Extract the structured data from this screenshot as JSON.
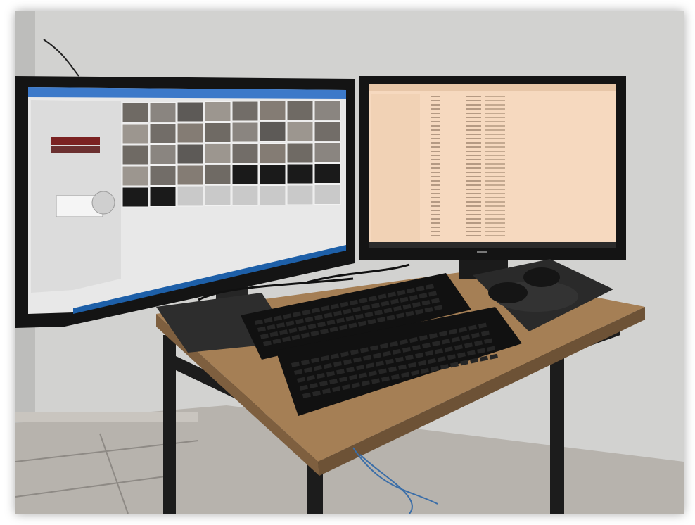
{
  "photo": {
    "subject": "",
    "colors": {
      "wall": "#d2d2d0",
      "wall_shadow": "#bdbdbb",
      "floor": "#b7b3ad",
      "desk_top": "#a57f55",
      "desk_frame": "#1c1c1c",
      "monitor_bezel": "#141414",
      "vms_screen": "#e8e8e8",
      "log_screen": "#f6d9bf",
      "taskbar": "#1d5fa8",
      "keyboard": "#111111",
      "mousepad": "#2a2a2a"
    }
  },
  "left_monitor": {
    "camera_tiles_filled": 28,
    "camera_tiles_dark": 6
  },
  "right_monitor": {
    "log_rows": 34
  }
}
